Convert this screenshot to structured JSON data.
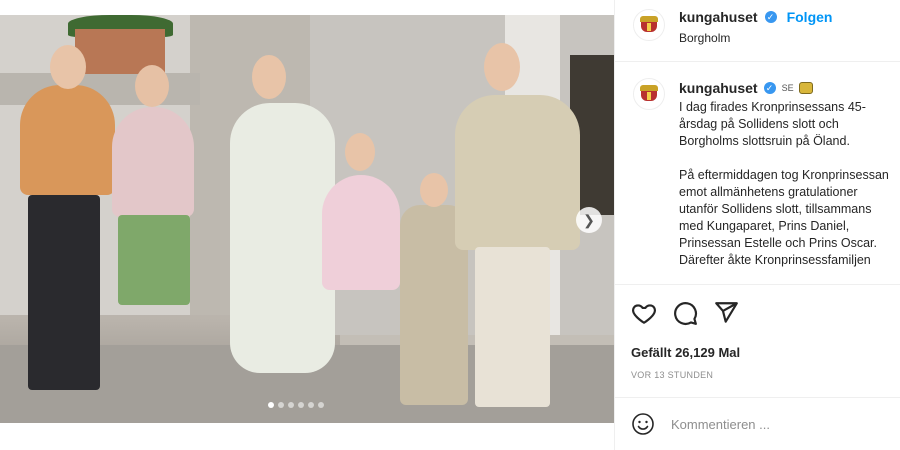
{
  "post": {
    "username": "kungahuset",
    "follow_label": "Folgen",
    "location": "Borgholm",
    "country_tag": "SE",
    "caption": "I dag firades Kronprinsessans 45-\nårsdag på Sollidens slott och\nBorgholms slottsruin på Öland.\n\nPå eftermiddagen tog Kronprinsessan\nemot allmänhetens gratulationer\nutanför Sollidens slott, tillsammans\nmed Kungaparet, Prins Daniel,\nPrinsessan Estelle och Prins Oscar.\nDärefter åkte Kronprinsessfamiljen",
    "likes_text": "Gefällt 26,129 Mal",
    "time_text": "VOR 13 STUNDEN",
    "comment_placeholder": "Kommentieren ..."
  },
  "carousel": {
    "slide_count": 6,
    "active_index": 0,
    "next_icon": "chevron-right-icon"
  },
  "icons": {
    "like": "heart-icon",
    "comment": "comment-icon",
    "share": "share-icon",
    "emoji": "emoji-icon",
    "verified": "verified-badge-icon"
  },
  "colors": {
    "accent": "#0095f6",
    "verified": "#3897f0",
    "text": "#262626",
    "muted": "#8e8e8e"
  }
}
